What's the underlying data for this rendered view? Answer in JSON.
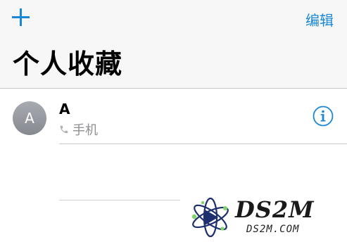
{
  "nav": {
    "add_icon": "plus-icon",
    "edit_label": "编辑",
    "title": "个人收藏"
  },
  "favorites": [
    {
      "avatar_initial": "A",
      "name": "A",
      "type_icon": "phone-icon",
      "type_label": "手机",
      "info_icon": "info-circle-icon"
    }
  ],
  "watermark": {
    "brand": "DS2M",
    "domain": "DS2M.COM"
  },
  "colors": {
    "accent": "#1a87d6",
    "nav_background": "#f7f7f7",
    "secondary_text": "#8e8e93",
    "separator": "#c8c7cc"
  }
}
